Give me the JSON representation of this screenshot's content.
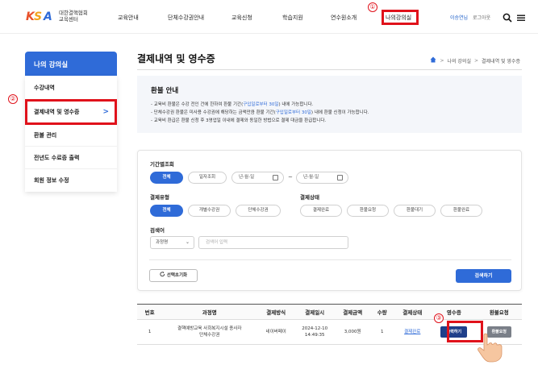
{
  "header": {
    "logo_mark": "KSA",
    "logo_line1": "대한결핵협회",
    "logo_line2": "교육센터",
    "nav": [
      "교육안내",
      "단체수강권안내",
      "교육신청",
      "학습지원",
      "연수원소개",
      "나의강의실"
    ],
    "user_name": "이승연님",
    "logout": "로그아웃"
  },
  "annotations": {
    "one": "①",
    "two": "②",
    "three": "③"
  },
  "sidebar": {
    "title": "나의 강의실",
    "items": [
      "수강내역",
      "결제내역 및 영수증",
      "환불 관리",
      "전년도 수료증 출력",
      "회원 정보 수정"
    ],
    "chevron": ">"
  },
  "main": {
    "title": "결제내역 및 영수증",
    "breadcrumb": [
      "나의 강의실",
      "결제내역 및 영수증"
    ],
    "refund": {
      "title": "환불 안내",
      "line1_a": "- 교육비 환불은 수강 전인 건에 한하여 환불 기간(",
      "line1_b": "구입일로부터 30일",
      "line1_c": ") 내에 가능합니다.",
      "line2_a": "- 단체수강권 환불은 미사용 수강권에 해당하는 금액만큼 환불 기간(",
      "line2_b": "구입일로부터 30일",
      "line2_c": ") 내에 환불 신청이 가능합니다.",
      "line3": "- 교육비 환급은 환불 신청 후 3영업일 이내에 결제와 동일한 방법으로 결제 대금을 환급합니다."
    },
    "search": {
      "period_label": "기간별조회",
      "period_all": "전체",
      "period_date": "일자조회",
      "date_placeholder": "년-월-일",
      "tilde": "~",
      "paytype_label": "결제유형",
      "paytype": [
        "전체",
        "개별수강권",
        "단체수강권"
      ],
      "status_label": "결제상태",
      "status": [
        "결제완료",
        "환불요청",
        "환불대기",
        "환불완료"
      ],
      "keyword_label": "검색어",
      "keyword_select": "과정명",
      "keyword_placeholder": "검색어 입력",
      "reset": "선택초기화",
      "submit": "검색하기"
    },
    "table": {
      "headers": [
        "번호",
        "과정명",
        "결제방식",
        "결제일시",
        "결제금액",
        "수량",
        "결제상태",
        "영수증",
        "환불요청"
      ],
      "rows": [
        {
          "no": "1",
          "course_line1": "결핵예방교육 사회복지시설 종사자",
          "course_line2": "단체수강권",
          "method": "네이버페이",
          "date_line1": "2024-12-10",
          "date_line2": "14:49:35",
          "amount": "3,000원",
          "qty": "1",
          "status": "결제완료",
          "receipt_btn": "출력하기",
          "refund_btn": "환불요청"
        }
      ]
    }
  },
  "colors": {
    "accent": "#2f6bd8",
    "highlight": "#e0121b",
    "dark_button": "#1f3f8a"
  }
}
